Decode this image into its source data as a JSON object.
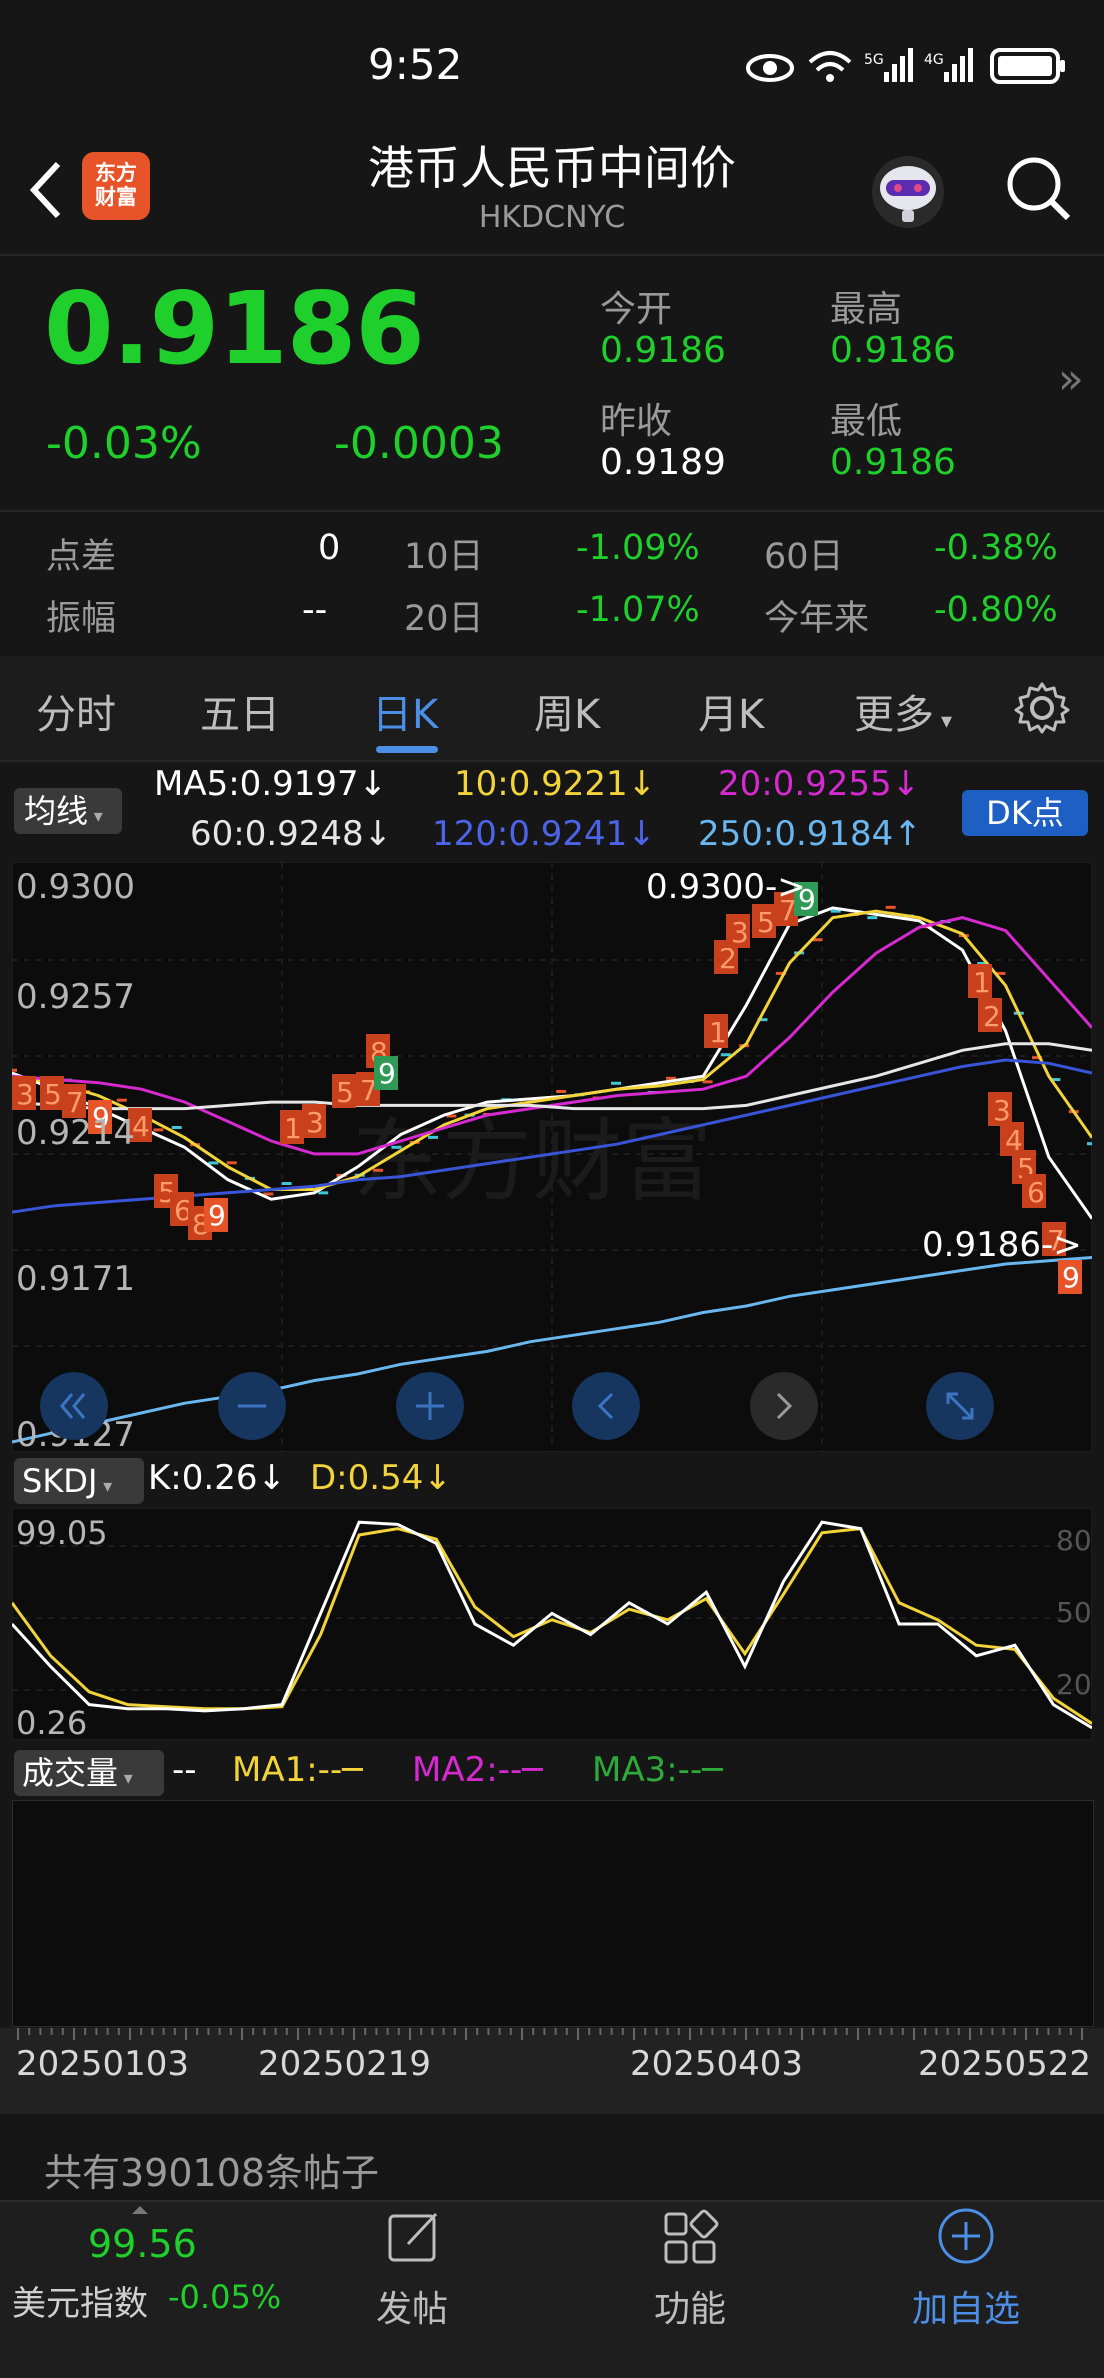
{
  "status_bar": {
    "time": "9:52",
    "network_1": "5G",
    "network_2": "4G"
  },
  "header": {
    "logo_text_1": "东方",
    "logo_text_2": "财富",
    "title": "港币人民币中间价",
    "code": "HKDCNYC"
  },
  "quote": {
    "price": "0.9186",
    "change_pct": "-0.03%",
    "change": "-0.0003",
    "open_label": "今开",
    "open": "0.9186",
    "high_label": "最高",
    "high": "0.9186",
    "prev_close_label": "昨收",
    "prev_close": "0.9189",
    "low_label": "最低",
    "low": "0.9186",
    "more_glyph": "»"
  },
  "stats": {
    "spread_label": "点差",
    "spread": "0",
    "amplitude_label": "振幅",
    "amplitude": "--",
    "d10_label": "10日",
    "d10": "-1.09%",
    "d20_label": "20日",
    "d20": "-1.07%",
    "d60_label": "60日",
    "d60": "-0.38%",
    "ytd_label": "今年来",
    "ytd": "-0.80%"
  },
  "tabs": [
    "分时",
    "五日",
    "日K",
    "周K",
    "月K",
    "更多"
  ],
  "active_tab": "日K",
  "ma_legend": {
    "button": "均线",
    "ma5": "MA5:0.9197↓",
    "ma10": "10:0.9221↓",
    "ma20": "20:0.9255↓",
    "ma60": "60:0.9248↓",
    "ma120": "120:0.9241↓",
    "ma250": "250:0.9184↑",
    "dk_button": "DK点"
  },
  "colors": {
    "ma5": "#ffffff",
    "ma10": "#f2d43a",
    "ma20": "#d62ad1",
    "ma60": "#e6e6e6",
    "ma120": "#3a54d8",
    "ma250": "#6ab7f0",
    "up": "#e8542a",
    "down": "#1fcf2b",
    "accent": "#4d8ee6"
  },
  "price_axis": [
    "0.9300",
    "0.9257",
    "0.9214",
    "0.9171",
    "0.9127"
  ],
  "annotations": {
    "max": "0.9300->",
    "last": "0.9186->"
  },
  "chart_data": {
    "type": "line",
    "title": "",
    "x_ticks": [
      "20250103",
      "20250219",
      "20250403",
      "20250522"
    ],
    "ylim": [
      0.9127,
      0.93
    ],
    "series": [
      {
        "name": "MA5",
        "values": [
          0.9241,
          0.9236,
          0.923,
          0.9224,
          0.9218,
          0.9208,
          0.9202,
          0.9204,
          0.9212,
          0.9222,
          0.9228,
          0.9232,
          0.9233,
          0.9234,
          0.9236,
          0.9238,
          0.924,
          0.9262,
          0.9287,
          0.9292,
          0.929,
          0.9288,
          0.9279,
          0.9254,
          0.9215,
          0.9196
        ]
      },
      {
        "name": "MA10",
        "values": [
          0.924,
          0.9238,
          0.9234,
          0.9228,
          0.9221,
          0.9212,
          0.9205,
          0.9205,
          0.9209,
          0.9217,
          0.9225,
          0.923,
          0.9232,
          0.9234,
          0.9236,
          0.9237,
          0.9239,
          0.925,
          0.9275,
          0.9289,
          0.9291,
          0.9289,
          0.9284,
          0.9268,
          0.924,
          0.9221
        ]
      },
      {
        "name": "MA20",
        "values": [
          0.924,
          0.9239,
          0.9238,
          0.9236,
          0.9232,
          0.9226,
          0.922,
          0.9216,
          0.9216,
          0.922,
          0.9224,
          0.9228,
          0.923,
          0.9232,
          0.9234,
          0.9235,
          0.9236,
          0.924,
          0.9252,
          0.9266,
          0.9278,
          0.9286,
          0.9289,
          0.9285,
          0.927,
          0.9255
        ]
      },
      {
        "name": "MA60",
        "values": [
          0.9232,
          0.9231,
          0.923,
          0.923,
          0.923,
          0.9231,
          0.9232,
          0.9232,
          0.9231,
          0.9231,
          0.9231,
          0.9231,
          0.9231,
          0.923,
          0.923,
          0.923,
          0.923,
          0.9231,
          0.9234,
          0.9237,
          0.924,
          0.9244,
          0.9248,
          0.925,
          0.925,
          0.9248
        ]
      },
      {
        "name": "MA120",
        "values": [
          0.9198,
          0.92,
          0.9201,
          0.9202,
          0.9203,
          0.9204,
          0.9205,
          0.9206,
          0.9208,
          0.9209,
          0.9211,
          0.9213,
          0.9215,
          0.9217,
          0.9219,
          0.9222,
          0.9225,
          0.9228,
          0.9231,
          0.9234,
          0.9237,
          0.924,
          0.9243,
          0.9245,
          0.9244,
          0.9241
        ]
      },
      {
        "name": "MA250",
        "values": [
          0.9127,
          0.913,
          0.9133,
          0.9136,
          0.9139,
          0.9141,
          0.9143,
          0.9146,
          0.9148,
          0.9151,
          0.9153,
          0.9155,
          0.9158,
          0.916,
          0.9162,
          0.9164,
          0.9167,
          0.9169,
          0.9172,
          0.9174,
          0.9176,
          0.9178,
          0.918,
          0.9182,
          0.9183,
          0.9184
        ]
      }
    ]
  },
  "skdj": {
    "button": "SKDJ",
    "k": "K:0.26↓",
    "d": "D:0.54↓",
    "y_top": "99.05",
    "y_bottom": "0.26",
    "right_ticks": [
      "80",
      "50",
      "20"
    ],
    "k_values": [
      50,
      30,
      12,
      10,
      10,
      9,
      10,
      12,
      55,
      98,
      97,
      88,
      50,
      40,
      55,
      45,
      60,
      50,
      65,
      30,
      70,
      98,
      95,
      50,
      50,
      35,
      40,
      12,
      1
    ],
    "d_values": [
      60,
      35,
      18,
      12,
      11,
      10,
      10,
      11,
      45,
      92,
      95,
      90,
      58,
      44,
      52,
      46,
      57,
      52,
      62,
      36,
      64,
      93,
      95,
      60,
      52,
      40,
      38,
      15,
      3
    ]
  },
  "volume": {
    "button": "成交量",
    "value": "--",
    "ma1": "MA1:--",
    "ma2": "MA2:--",
    "ma3": "MA3:--"
  },
  "posts": "共有390108条帖子",
  "bottom": {
    "index_value": "99.56",
    "index_name": "美元指数",
    "index_change": "-0.05%",
    "post": "发帖",
    "function": "功能",
    "add": "加自选"
  }
}
